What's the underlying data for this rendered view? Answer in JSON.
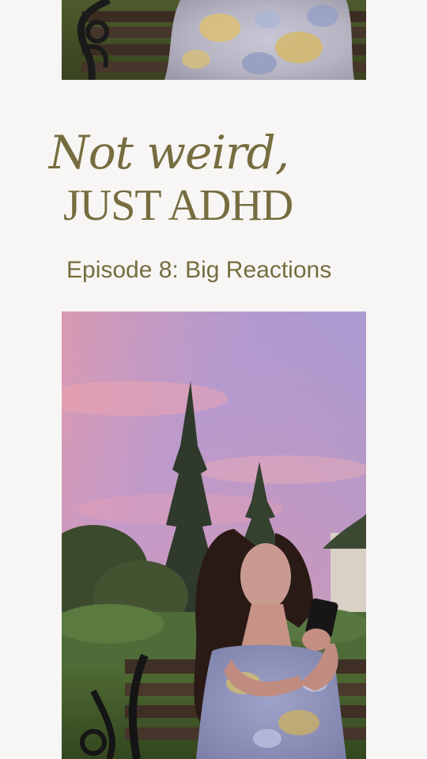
{
  "title": {
    "line1": "Not weird,",
    "line2": "JUST ADHD"
  },
  "episode": "Episode 8: Big Reactions",
  "colors": {
    "background": "#f8f6f4",
    "title_text": "#766d40"
  },
  "images": {
    "top": "photo-floral-dress-bench",
    "bottom": "photo-woman-phone-sunset"
  }
}
